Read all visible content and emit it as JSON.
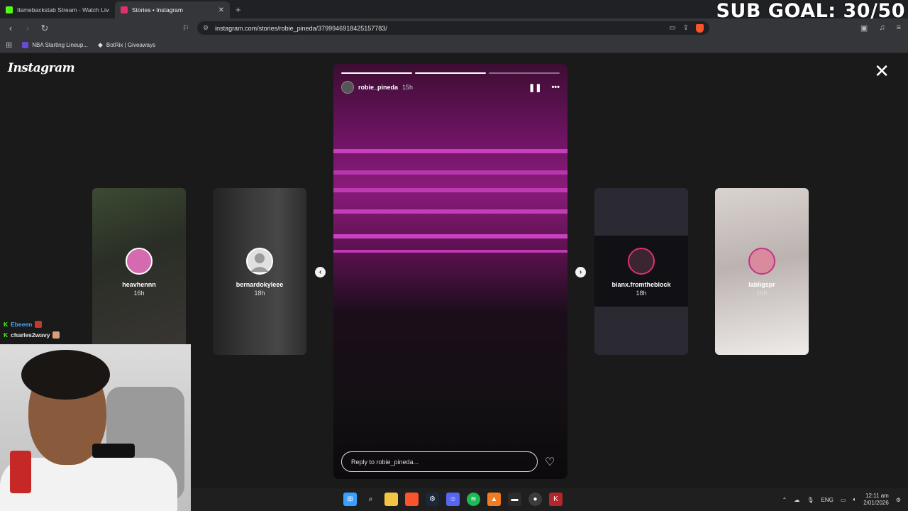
{
  "browser": {
    "tabs": [
      {
        "title": "Itsmebackstab Stream - Watch Live o",
        "color": "#53fc18",
        "active": false
      },
      {
        "title": "Stories • Instagram",
        "color": "#e1306c",
        "active": true
      }
    ],
    "url": "instagram.com/stories/robie_pineda/3799946918425157783/",
    "bookmarks": [
      {
        "label": "NBA Starting Lineup...",
        "color": "#6a4bd8"
      },
      {
        "label": "BotRix | Giveaways",
        "color": "#e8e8e8"
      }
    ]
  },
  "overlay": {
    "sub_goal": "SUB GOAL: 30/50",
    "chat": [
      {
        "user": "Ebeeen",
        "color": "#4aa3ff"
      },
      {
        "user": "charles2wavy",
        "color": "#e8e8e8"
      }
    ]
  },
  "instagram": {
    "logo": "Instagram",
    "close_icon": "close-icon",
    "active_story": {
      "username": "robie_pineda",
      "age": "15h",
      "reply_placeholder": "Reply to robie_pineda...",
      "progress_segments": [
        1,
        1,
        0
      ]
    },
    "side_stories": [
      {
        "username": "heavhennn",
        "age": "16h",
        "avatar_color": "#d46bb0"
      },
      {
        "username": "bernardokyleee",
        "age": "18h",
        "avatar_color": "#cfcfcf"
      },
      {
        "username": "bianx.fromtheblock",
        "age": "18h",
        "avatar_color": "#3a2530"
      },
      {
        "username": "labligspr",
        "age": "16h",
        "avatar_color": "#d98a9c"
      }
    ]
  },
  "taskbar": {
    "language": "ENG",
    "time": "12:11 am",
    "date": "2/01/2026",
    "apps": [
      {
        "name": "windows-start-icon",
        "color": "#3aa0ff"
      },
      {
        "name": "search-icon",
        "color": "#2a2a2a"
      },
      {
        "name": "file-explorer-icon",
        "color": "#f4c542"
      },
      {
        "name": "brave-icon",
        "color": "#fb542b"
      },
      {
        "name": "steam-icon",
        "color": "#1b2838"
      },
      {
        "name": "discord-icon",
        "color": "#5865f2"
      },
      {
        "name": "spotify-icon",
        "color": "#1db954"
      },
      {
        "name": "app-orange-icon",
        "color": "#f47b20"
      },
      {
        "name": "terminal-icon",
        "color": "#2b2b2b"
      },
      {
        "name": "obs-icon",
        "color": "#3c3c3c"
      },
      {
        "name": "kick-icon",
        "color": "#b3262b"
      }
    ]
  }
}
